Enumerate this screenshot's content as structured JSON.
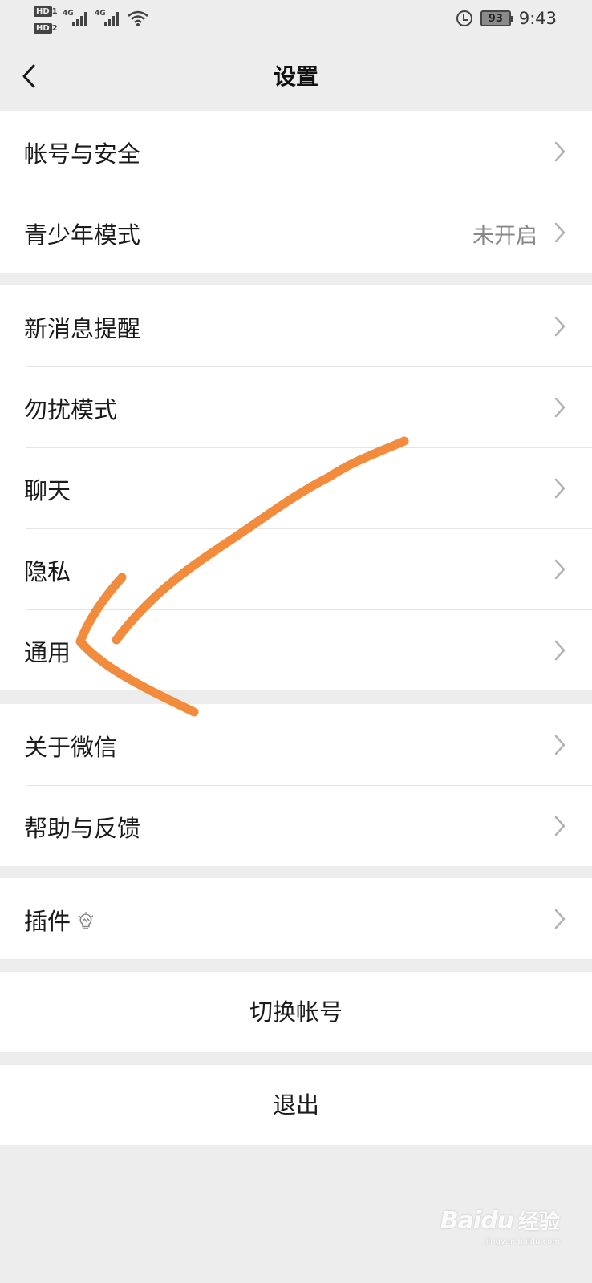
{
  "status_bar": {
    "hd1": "HD",
    "hd1_sub": "1",
    "hd2": "HD",
    "hd2_sub": "2",
    "net1": "4G",
    "net2": "4G",
    "battery": "93",
    "time": "9:43",
    "icons": [
      "hd-icon",
      "signal-icon",
      "signal-icon",
      "wifi-icon",
      "alarm-icon",
      "battery-icon"
    ]
  },
  "nav": {
    "title": "设置",
    "back_icon": "chevron-left-icon"
  },
  "groups": [
    {
      "items": [
        {
          "label": "帐号与安全"
        },
        {
          "label": "青少年模式",
          "value": "未开启"
        }
      ]
    },
    {
      "items": [
        {
          "label": "新消息提醒"
        },
        {
          "label": "勿扰模式"
        },
        {
          "label": "聊天"
        },
        {
          "label": "隐私"
        },
        {
          "label": "通用"
        }
      ]
    },
    {
      "items": [
        {
          "label": "关于微信"
        },
        {
          "label": "帮助与反馈"
        }
      ]
    },
    {
      "items": [
        {
          "label": "插件",
          "icon": "lightbulb-icon"
        }
      ]
    }
  ],
  "actions": {
    "switch_account": "切换帐号",
    "logout": "退出"
  },
  "annotation": {
    "type": "hand-drawn arrow",
    "color": "#f28b3c",
    "points_to": "通用"
  },
  "watermark": {
    "logo": "Bai",
    "logo2": "du",
    "text": "经验",
    "url": "jingyan.baidu.com"
  },
  "colors": {
    "background": "#ededed",
    "cell": "#ffffff",
    "text": "#1a1a1a",
    "secondary": "#888888",
    "divider": "#e5e5e5",
    "annotation": "#f28b3c"
  }
}
